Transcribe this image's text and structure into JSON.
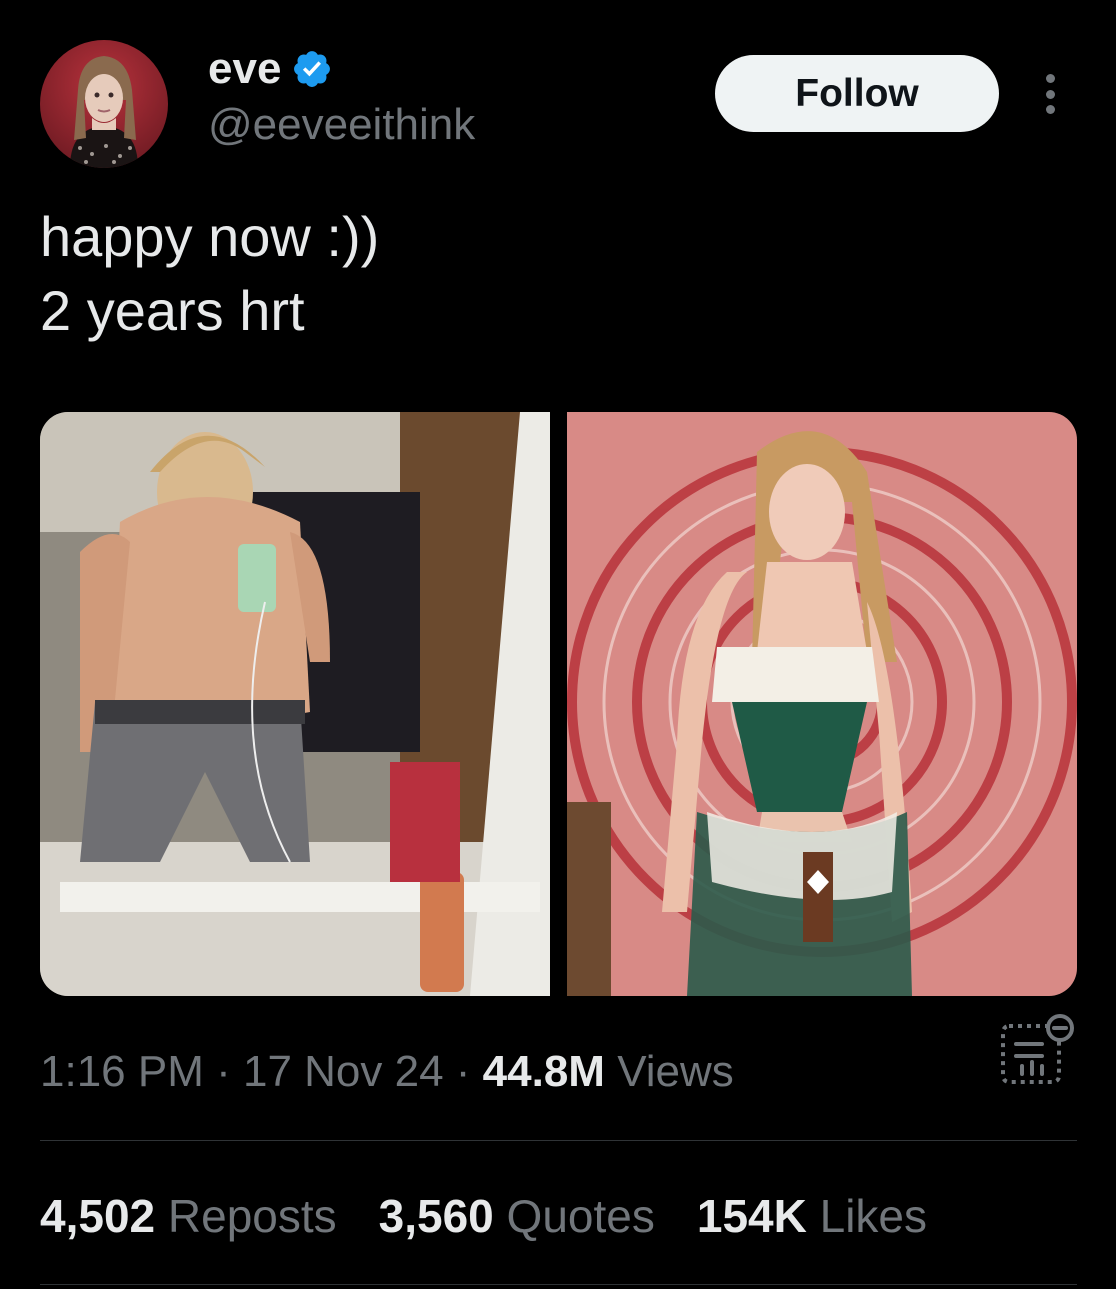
{
  "user": {
    "display_name": "eve",
    "handle": "@eeveeithink",
    "verified": true
  },
  "actions": {
    "follow_label": "Follow"
  },
  "tweet": {
    "lines": [
      "happy now :))",
      "2 years hrt"
    ]
  },
  "meta": {
    "time": "1:16 PM",
    "sep1": " · ",
    "date": "17 Nov 24",
    "sep2": " · ",
    "views_count": "44.8M",
    "views_label": " Views"
  },
  "stats": {
    "reposts_count": "4,502",
    "reposts_label": " Reposts",
    "quotes_count": "3,560",
    "quotes_label": " Quotes",
    "likes_count": "154K",
    "likes_label": " Likes"
  },
  "colors": {
    "background": "#000000",
    "text": "#e7e9ea",
    "secondary": "#71767b",
    "verified": "#1d9bf0",
    "divider": "#2f3336"
  },
  "icons": {
    "verified": "verified-badge-icon",
    "more": "more-dots-icon",
    "analytics": "analytics-icon"
  }
}
